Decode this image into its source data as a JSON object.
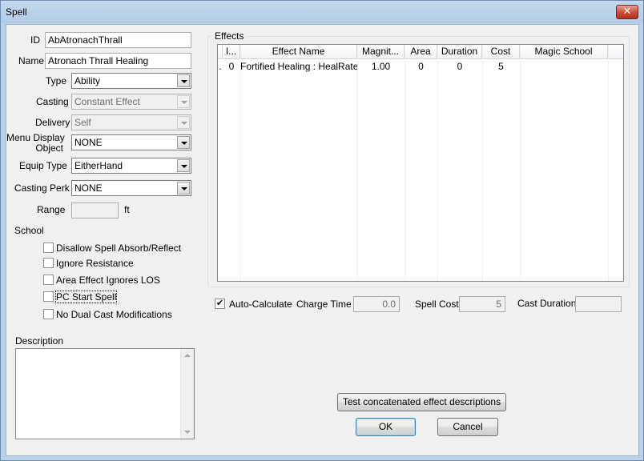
{
  "window": {
    "title": "Spell",
    "close_label": "✕"
  },
  "form": {
    "id_label": "ID",
    "id_value": "AbAtronachThrall",
    "name_label": "Name",
    "name_value": "Atronach Thrall Healing",
    "type_label": "Type",
    "type_value": "Ability",
    "casting_label": "Casting",
    "casting_value": "Constant Effect",
    "delivery_label": "Delivery",
    "delivery_value": "Self",
    "menu_display_label_line1": "Menu Display",
    "menu_display_label_line2": "Object",
    "menu_display_value": "NONE",
    "equip_type_label": "Equip Type",
    "equip_type_value": "EitherHand",
    "casting_perk_label": "Casting Perk",
    "casting_perk_value": "NONE",
    "range_label": "Range",
    "range_value": "",
    "range_unit": "ft",
    "school_label": "School",
    "checkboxes": [
      {
        "label": "Disallow Spell Absorb/Reflect",
        "checked": false
      },
      {
        "label": "Ignore Resistance",
        "checked": false
      },
      {
        "label": "Area Effect Ignores LOS",
        "checked": false
      },
      {
        "label": "PC Start Spell",
        "checked": false
      },
      {
        "label": "No Dual Cast Modifications",
        "checked": false
      }
    ],
    "description_label": "Description",
    "description_value": ""
  },
  "effects": {
    "group_label": "Effects",
    "columns": [
      "I...",
      "Effect Name",
      "Magnit...",
      "Area",
      "Duration",
      "Cost",
      "Magic School"
    ],
    "rows": [
      {
        "marker": ".",
        "index": "0",
        "effect_name": "Fortified Healing : HealRate",
        "magnitude": "1.00",
        "area": "0",
        "duration": "0",
        "cost": "5",
        "magic_school": ""
      }
    ]
  },
  "costs": {
    "auto_calc_label": "Auto-Calculate",
    "auto_calc_checked": true,
    "charge_time_label": "Charge Time",
    "charge_time_value": "0.0",
    "spell_cost_label": "Spell Cost",
    "spell_cost_value": "5",
    "cast_duration_label": "Cast Duration",
    "cast_duration_value": ""
  },
  "buttons": {
    "test_desc": "Test concatenated effect descriptions",
    "ok": "OK",
    "cancel": "Cancel"
  }
}
